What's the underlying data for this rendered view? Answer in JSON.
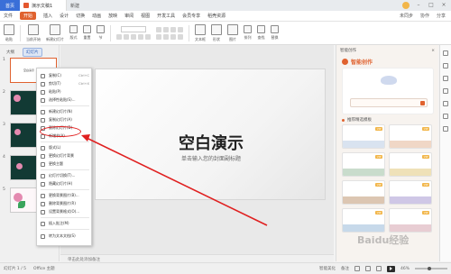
{
  "titlebar": {
    "home_tab": "首页",
    "doc_tab": "演示文稿1",
    "new_tab_label": "新建"
  },
  "menubar": {
    "items": [
      "文件",
      "开始",
      "插入",
      "设计",
      "切换",
      "动画",
      "放映",
      "审阅",
      "视图",
      "开发工具",
      "会员专享",
      "稻壳资源"
    ],
    "active_index": 1,
    "right_items": [
      "未同步",
      "协作",
      "分享"
    ]
  },
  "ribbon": {
    "labels": [
      "粘贴",
      "当前开始",
      "新建幻灯片",
      "版式",
      "重置",
      "节",
      "文本框",
      "形状",
      "图片",
      "排列",
      "查找",
      "替换"
    ]
  },
  "left_panel": {
    "tabs": [
      "大纲",
      "幻灯片"
    ],
    "active_tab": 1,
    "slide_numbers": [
      "1",
      "2",
      "3",
      "4",
      "5"
    ],
    "thumb1_title": "空白演示"
  },
  "context_menu": {
    "items": [
      {
        "label": "复制(C)",
        "shortcut": "Ctrl+C"
      },
      {
        "label": "剪切(T)",
        "shortcut": "Ctrl+X"
      },
      {
        "label": "粘贴(P)",
        "shortcut": ""
      },
      {
        "label": "选择性粘贴(S)...",
        "shortcut": ""
      },
      {
        "label": "新建幻灯片(N)",
        "shortcut": ""
      },
      {
        "label": "复制幻灯片(A)",
        "shortcut": ""
      },
      {
        "label": "删除幻灯片(D)",
        "shortcut": ""
      },
      {
        "label": "新增节(A)",
        "shortcut": ""
      },
      {
        "label": "版式(L)",
        "shortcut": ""
      },
      {
        "label": "更换幻灯片背景",
        "shortcut": ""
      },
      {
        "label": "更换主题",
        "shortcut": ""
      },
      {
        "label": "幻灯片切换(T)...",
        "shortcut": ""
      },
      {
        "label": "隐藏幻灯片(H)",
        "shortcut": ""
      },
      {
        "label": "更换背景图片(B)...",
        "shortcut": ""
      },
      {
        "label": "删除背景图片(R)",
        "shortcut": ""
      },
      {
        "label": "设置背景格式(O)...",
        "shortcut": ""
      },
      {
        "label": "插入批注(M)",
        "shortcut": ""
      },
      {
        "label": "转为文本文档(S)",
        "shortcut": ""
      }
    ],
    "highlighted_index": 6
  },
  "slide": {
    "title": "空白演示",
    "subtitle": "单击输入您的封面副标题"
  },
  "notes_placeholder": "单击此处添加备注",
  "right_panel": {
    "header": "智能创作",
    "brand": "智能创作",
    "section_title": "推荐精选模板"
  },
  "statusbar": {
    "slide_count": "幻灯片 1 / 5",
    "theme": "Office 主题",
    "smart_beautify": "智能美化",
    "notes": "备注",
    "zoom": "46%"
  },
  "watermark": "Baidu经验",
  "colors": {
    "accent": "#e0622f",
    "home_tab": "#3a6fd8",
    "annotation": "#e02020"
  }
}
